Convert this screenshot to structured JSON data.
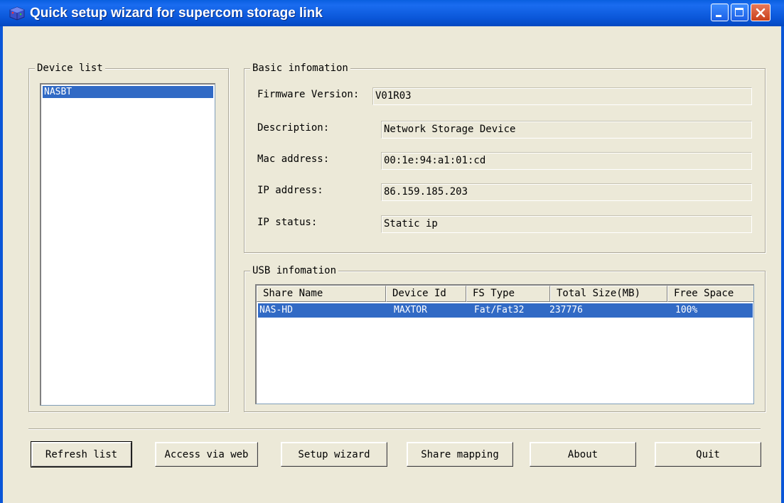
{
  "window": {
    "title": "Quick setup wizard for supercom storage link",
    "icon": "storage-cube-icon"
  },
  "device_list": {
    "legend": "Device list",
    "items": [
      "NASBT"
    ],
    "selected_index": 0
  },
  "basic_info": {
    "legend": "Basic infomation",
    "rows": [
      {
        "label": "Firmware Version:",
        "value": "V01R03"
      },
      {
        "label": "Description:",
        "value": "Network Storage Device"
      },
      {
        "label": "Mac address:",
        "value": "00:1e:94:a1:01:cd"
      },
      {
        "label": "IP address:",
        "value": "86.159.185.203"
      },
      {
        "label": "IP status:",
        "value": "Static ip"
      }
    ]
  },
  "usb_info": {
    "legend": "USB infomation",
    "columns": [
      "Share Name",
      "Device Id",
      "FS Type",
      "Total Size(MB)",
      "Free Space"
    ],
    "rows": [
      [
        "NAS-HD",
        "MAXTOR",
        "Fat/Fat32",
        "237776",
        "100%"
      ]
    ]
  },
  "buttons": {
    "refresh": "Refresh list",
    "access_web": "Access via web",
    "setup_wizard": "Setup wizard",
    "share_mapping": "Share mapping",
    "about": "About",
    "quit": "Quit"
  },
  "colors": {
    "titlebar": "#0a56d8",
    "client_bg": "#ece9d8",
    "selection": "#316ac5"
  }
}
